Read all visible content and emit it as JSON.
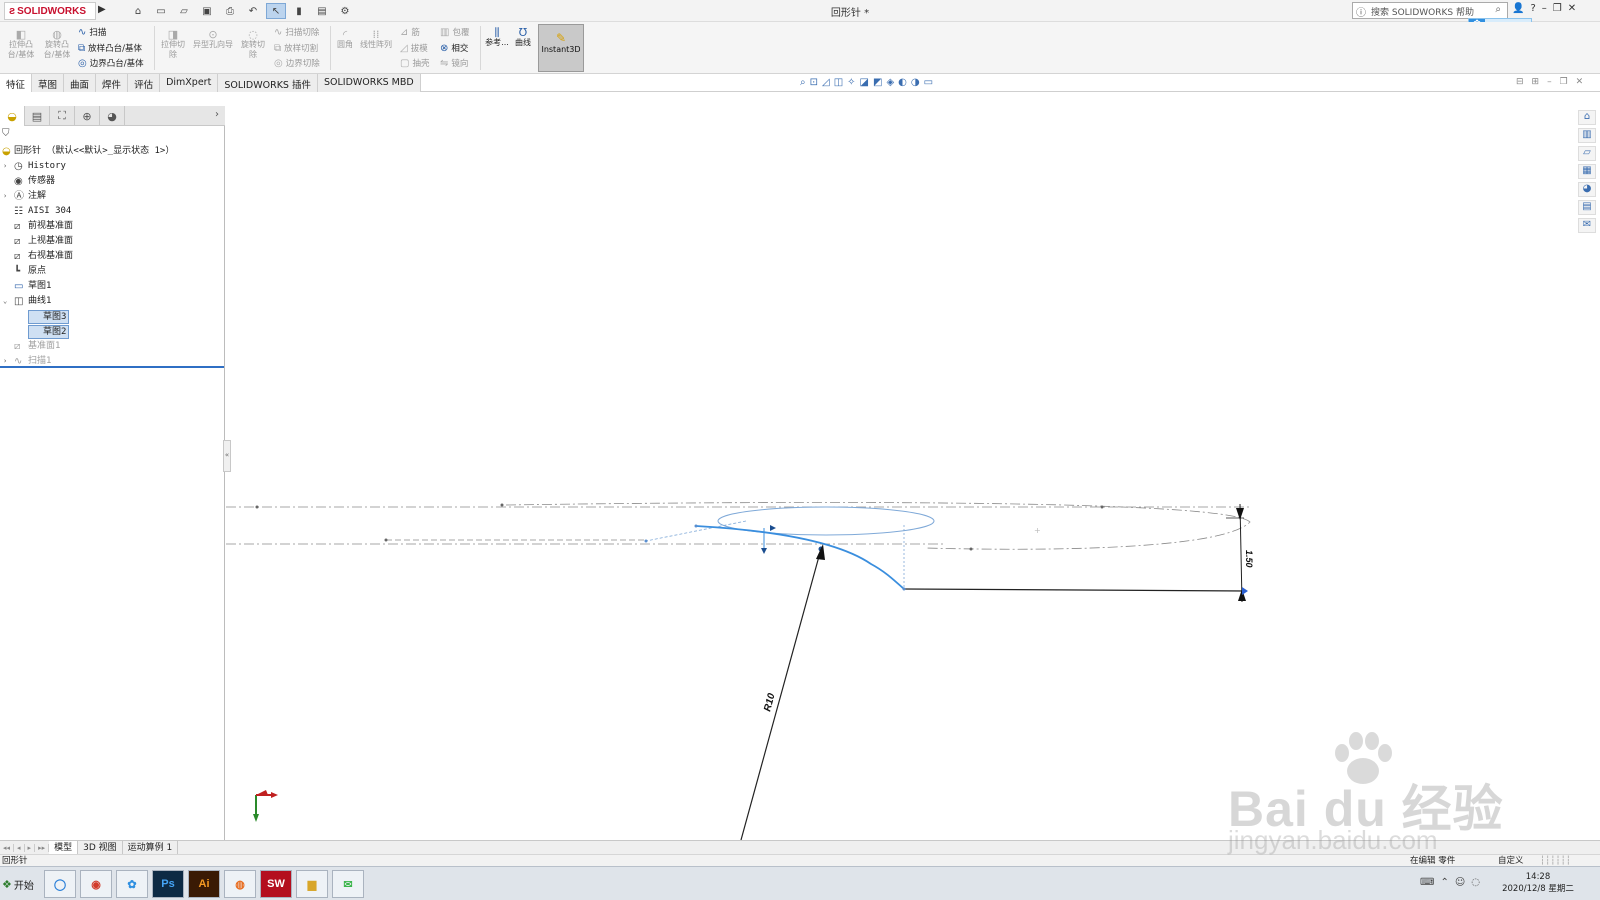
{
  "app": {
    "logo": "SOLIDWORKS",
    "doc_title": "回形针 *",
    "help_search_placeholder": "搜索 SOLIDWORKS 帮助"
  },
  "command_manager": {
    "extrude_boss": "拉伸凸台/基体",
    "revolve_boss": "旋转凸台/基体",
    "sweep": "扫描",
    "loft_boss": "放样凸台/基体",
    "boundary_boss": "边界凸台/基体",
    "extrude_cut": "拉伸切除",
    "hole_wizard": "异型孔向导",
    "revolve_cut": "旋转切除",
    "swept_cut": "扫描切除",
    "lofted_cut": "放样切割",
    "boundary_cut": "边界切除",
    "fillet": "圆角",
    "linear_pattern": "线性阵列",
    "rib": "筋",
    "draft": "拔模",
    "shell": "抽壳",
    "wrap": "包覆",
    "intersect": "相交",
    "mirror": "镜向",
    "reference": "参考...",
    "curves": "曲线",
    "instant3d": "Instant3D"
  },
  "tabs": [
    "特征",
    "草图",
    "曲面",
    "焊件",
    "评估",
    "DimXpert",
    "SOLIDWORKS 插件",
    "SOLIDWORKS MBD"
  ],
  "feature_tree": {
    "root": "回形针 （默认<<默认>_显示状态 1>）",
    "items": [
      {
        "label": "History",
        "icon": "history-icon",
        "expandable": true
      },
      {
        "label": "传感器",
        "icon": "sensor-icon",
        "expandable": false
      },
      {
        "label": "注解",
        "icon": "annotation-icon",
        "expandable": true
      },
      {
        "label": "AISI 304",
        "icon": "material-icon",
        "expandable": false
      },
      {
        "label": "前视基准面",
        "icon": "plane-icon",
        "expandable": false
      },
      {
        "label": "上视基准面",
        "icon": "plane-icon",
        "expandable": false
      },
      {
        "label": "右视基准面",
        "icon": "plane-icon",
        "expandable": false
      },
      {
        "label": "原点",
        "icon": "origin-icon",
        "expandable": false
      },
      {
        "label": "草图1",
        "icon": "sketch-icon",
        "expandable": false
      },
      {
        "label": "曲线1",
        "icon": "curve-icon",
        "expandable": true
      },
      {
        "label": "草图3",
        "icon": "sketch-icon",
        "child": true
      },
      {
        "label": "草图2",
        "icon": "sketch-icon",
        "child": true
      },
      {
        "label": "基准面1",
        "icon": "plane-icon",
        "dim": true
      },
      {
        "label": "扫描1",
        "icon": "sweep-icon",
        "dim": true,
        "expandable": true
      }
    ]
  },
  "viewport": {
    "dimension_radius": "R10",
    "dimension_height": "1.50"
  },
  "bottom_tabs": [
    "模型",
    "3D 视图",
    "运动算例 1"
  ],
  "status": {
    "left": "回形针",
    "editing": "在编辑 零件",
    "custom": "自定义"
  },
  "taskbar": {
    "start": "开始",
    "time": "14:28",
    "date": "2020/12/8 星期二"
  },
  "watermark": {
    "brand": "Bai du 经验",
    "url": "jingyan.baidu.com"
  }
}
